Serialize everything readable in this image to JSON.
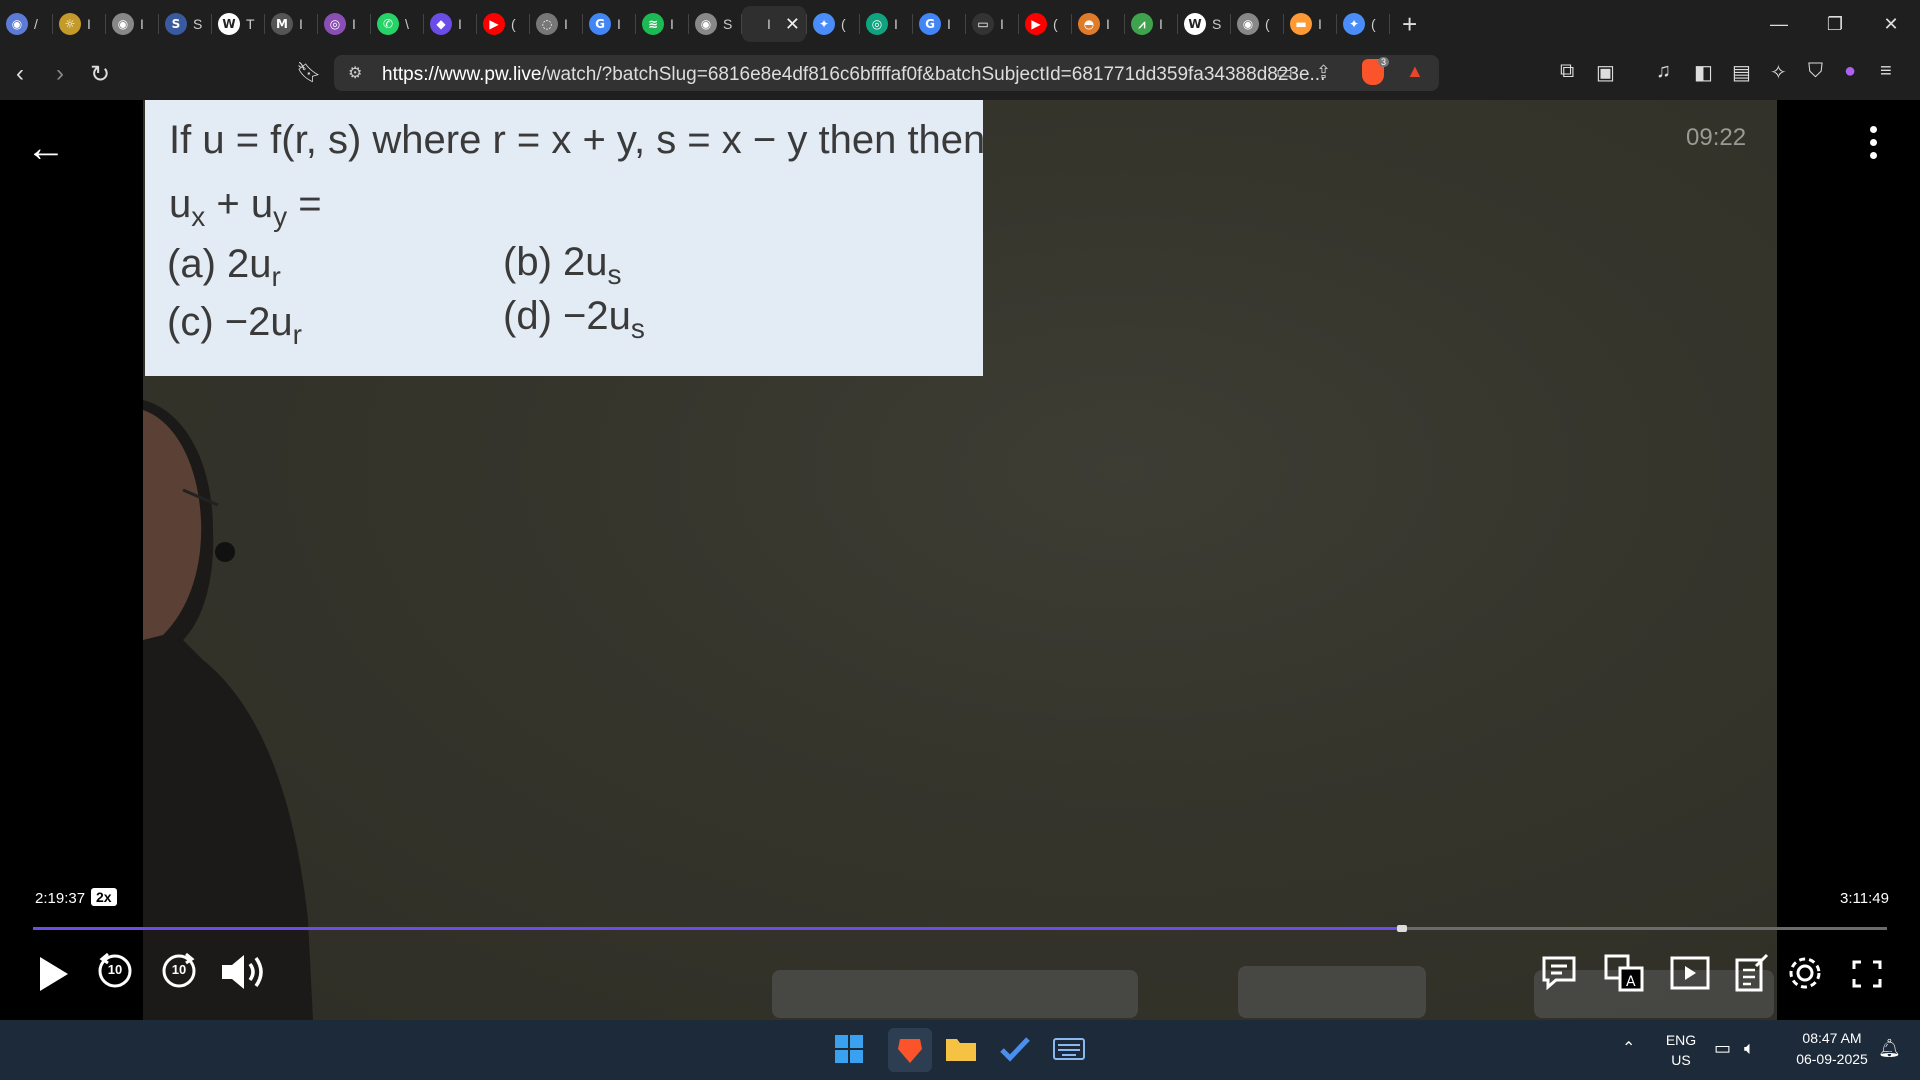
{
  "browser": {
    "tabs": [
      {
        "icon": "globe-icon",
        "color": "#5b7bd5",
        "glyph": "◉",
        "label": "/"
      },
      {
        "icon": "sun-icon",
        "color": "#c49a2a",
        "glyph": "☼",
        "label": "I"
      },
      {
        "icon": "globe-icon",
        "color": "#888888",
        "glyph": "◉",
        "label": "I"
      },
      {
        "icon": "sbl-icon",
        "color": "#3a5aa0",
        "glyph": "S",
        "label": "S"
      },
      {
        "icon": "w3-icon",
        "color": "#ffffff",
        "glyph": "W",
        "label": "T"
      },
      {
        "icon": "mail-icon",
        "color": "#555555",
        "glyph": "M",
        "label": "I"
      },
      {
        "icon": "brain-icon",
        "color": "#8a4fb5",
        "glyph": "◎",
        "label": "I"
      },
      {
        "icon": "whatsapp-icon",
        "color": "#25d366",
        "glyph": "✆",
        "label": "\\"
      },
      {
        "icon": "bookmark-icon",
        "color": "#6b4ce6",
        "glyph": "◆",
        "label": "I"
      },
      {
        "icon": "youtube-icon",
        "color": "#ff0000",
        "glyph": "▶",
        "label": "("
      },
      {
        "icon": "circle-icon",
        "color": "#777777",
        "glyph": "◌",
        "label": "I"
      },
      {
        "icon": "google-icon",
        "color": "#4285f4",
        "glyph": "G",
        "label": "I"
      },
      {
        "icon": "spotify-icon",
        "color": "#1db954",
        "glyph": "≋",
        "label": "I"
      },
      {
        "icon": "globe-icon",
        "color": "#888888",
        "glyph": "◉",
        "label": "S"
      },
      {
        "icon": "pw-icon",
        "color": "#2f2f2f",
        "glyph": "",
        "label": "I",
        "active": true
      },
      {
        "icon": "gemini-icon",
        "color": "#4b8df8",
        "glyph": "✦",
        "label": "("
      },
      {
        "icon": "chatgpt-icon",
        "color": "#10a37f",
        "glyph": "◎",
        "label": "I"
      },
      {
        "icon": "google-icon",
        "color": "#4285f4",
        "glyph": "G",
        "label": "I"
      },
      {
        "icon": "monitor-icon",
        "color": "#333333",
        "glyph": "▭",
        "label": "I"
      },
      {
        "icon": "youtube-icon",
        "color": "#ff0000",
        "glyph": "▶",
        "label": "("
      },
      {
        "icon": "burger-icon",
        "color": "#e07b2a",
        "glyph": "◓",
        "label": "I"
      },
      {
        "icon": "chart-icon",
        "color": "#3fa34d",
        "glyph": "⩘",
        "label": "I"
      },
      {
        "icon": "wikipedia-icon",
        "color": "#ffffff",
        "glyph": "W",
        "label": "S"
      },
      {
        "icon": "globe-icon",
        "color": "#888888",
        "glyph": "◉",
        "label": "("
      },
      {
        "icon": "flag-icon",
        "color": "#ff9933",
        "glyph": "▬",
        "label": "I"
      },
      {
        "icon": "gemini-icon",
        "color": "#4b8df8",
        "glyph": "✦",
        "label": "("
      }
    ],
    "url_host": "https://www.pw.live",
    "url_path": "/watch/?batchSlug=6816e8e4df816c6bffffaf0f&batchSubjectId=681771dd359fa34388d823e...",
    "brave_badge": "3"
  },
  "video": {
    "question": {
      "line1": "If u = f(r, s) where r = x + y, s = x − y then then",
      "line2_a": "u",
      "line2_a_sub": "x",
      "line2_b": " + u",
      "line2_b_sub": "y",
      "line2_c": " =",
      "opt_a": "(a) 2u",
      "opt_a_sub": "r",
      "opt_b": "(b) 2u",
      "opt_b_sub": "s",
      "opt_c": "(c) −2u",
      "opt_c_sub": "r",
      "opt_d": "(d) −2u",
      "opt_d_sub": "s"
    },
    "clock": "09:22",
    "current_time": "2:19:37",
    "speed": "2x",
    "total_time": "3:11:49",
    "progress": 0.7384,
    "accent": "#6c4ee6",
    "skip_back": "10",
    "skip_forward": "10"
  },
  "taskbar": {
    "lang_top": "ENG",
    "lang_bottom": "US",
    "time": "08:47 AM",
    "date": "06-09-2025"
  }
}
